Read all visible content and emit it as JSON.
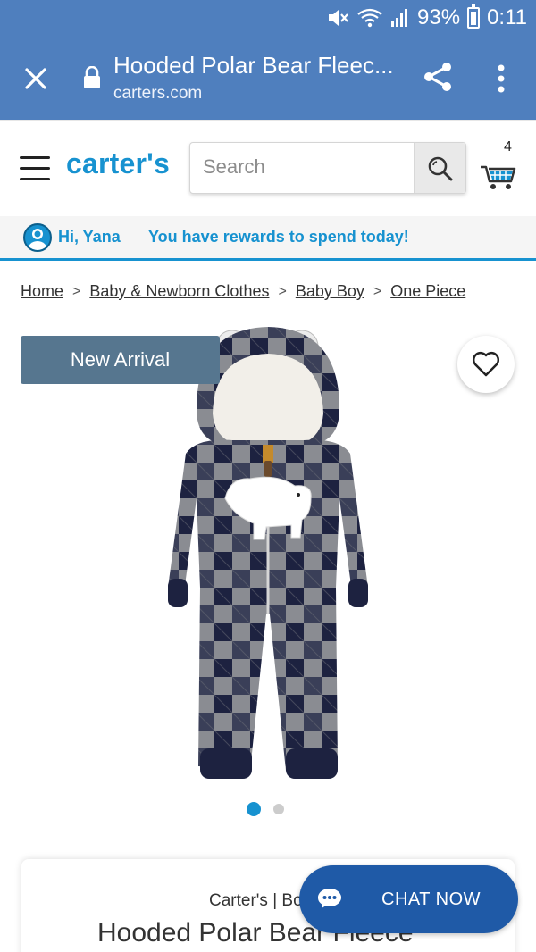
{
  "status_bar": {
    "battery": "93%",
    "time": "0:11",
    "icons": [
      "mute-icon",
      "wifi-icon",
      "signal-icon",
      "battery-icon"
    ]
  },
  "browser": {
    "tab_title": "Hooded Polar Bear Fleec...",
    "url": "carters.com",
    "icons": [
      "close-icon",
      "lock-icon",
      "share-icon",
      "more-vert-icon"
    ],
    "chrome_color": "#4f7fbe"
  },
  "header": {
    "logo": "carter's",
    "search_placeholder": "Search",
    "cart_count": "4",
    "brand_color": "#1792d0"
  },
  "rewards": {
    "greeting": "Hi, Yana",
    "message": "You have rewards to spend today!"
  },
  "breadcrumb": {
    "items": [
      "Home",
      "Baby & Newborn Clothes",
      "Baby Boy",
      "One Piece"
    ],
    "separator": ">"
  },
  "product": {
    "badge": "New Arrival",
    "image_alt": "Hooded Polar Bear Fleece jumpsuit",
    "carousel_total": 2,
    "carousel_active": 1,
    "brand_line": "Carter's | Bo",
    "name": "Hooded Polar Bear Fleece"
  },
  "chat": {
    "label": "CHAT NOW",
    "color": "#1f5aa7"
  }
}
